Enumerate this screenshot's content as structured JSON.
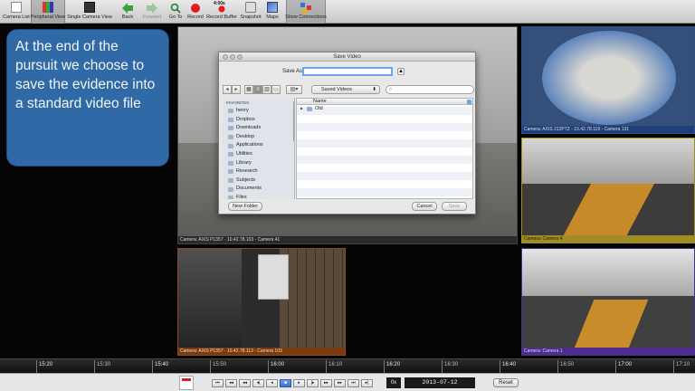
{
  "toolbar": {
    "items": [
      {
        "label": "Camera List",
        "icon": "document-list-icon"
      },
      {
        "label": "Peripheral View",
        "icon": "peripheral-view-icon",
        "active": true
      },
      {
        "label": "Single Camera View",
        "icon": "single-camera-icon"
      },
      {
        "label": "Back",
        "icon": "arrow-left-icon"
      },
      {
        "label": "Forward",
        "icon": "arrow-right-icon"
      },
      {
        "label": "Go To",
        "icon": "magnifier-icon"
      },
      {
        "label": "Record",
        "icon": "record-dot-icon"
      },
      {
        "label": "Record Buffer",
        "icon": "record-buffer-icon"
      },
      {
        "label": "Snapshot",
        "icon": "camera-icon"
      },
      {
        "label": "Maps",
        "icon": "map-icon"
      },
      {
        "label": "Show Connections",
        "icon": "connections-icon",
        "active": true
      }
    ],
    "buffer_badge": "4:00s"
  },
  "overlay": {
    "text": "At the end of the pursuit we choose to save the evidence into a standard video file",
    "color": "#2f6aa7"
  },
  "cameras": {
    "main": {
      "label": "Camera: AXIS P1357 - 10.42.78.103 - Camera 41"
    },
    "bottom_left": {
      "label": "Camera: AXIS P1357 - 10.42.78.113 - Camera 103"
    },
    "right_top": {
      "label": "Camera: AXIS 212PTZ - 10.42.78.119 - Camera 131"
    },
    "right_mid": {
      "label": "Camera: Camera 4"
    },
    "right_bottom": {
      "label": "Camera: Camera 1"
    }
  },
  "dialog": {
    "title": "Save Video",
    "save_as_label": "Save As:",
    "save_as_value": "",
    "expand_label": "▲",
    "location": "Saved Videos",
    "search_placeholder": "",
    "sidebar_header": "FAVORITES",
    "favorites": [
      "henry",
      "Dropbox",
      "Downloads",
      "Desktop",
      "Applications",
      "Utilities",
      "Library",
      "Research",
      "Subjects",
      "Documents",
      "Files"
    ],
    "column_name": "Name",
    "files": [
      "Old"
    ],
    "new_folder": "New Folder",
    "cancel": "Cancel",
    "save": "Save"
  },
  "timeline": {
    "ticks": [
      "15:20",
      "15:30",
      "15:40",
      "15:50",
      "16:00",
      "16:10",
      "16:20",
      "16:30",
      "16:40",
      "16:50",
      "17:00",
      "17:10"
    ],
    "major": [
      "15:20",
      "15:40",
      "16:00",
      "16:20",
      "16:40",
      "17:00"
    ]
  },
  "playback": {
    "speed": "0x",
    "datetime": "2013-07-12 16:13:40.28",
    "reset": "Reset"
  }
}
